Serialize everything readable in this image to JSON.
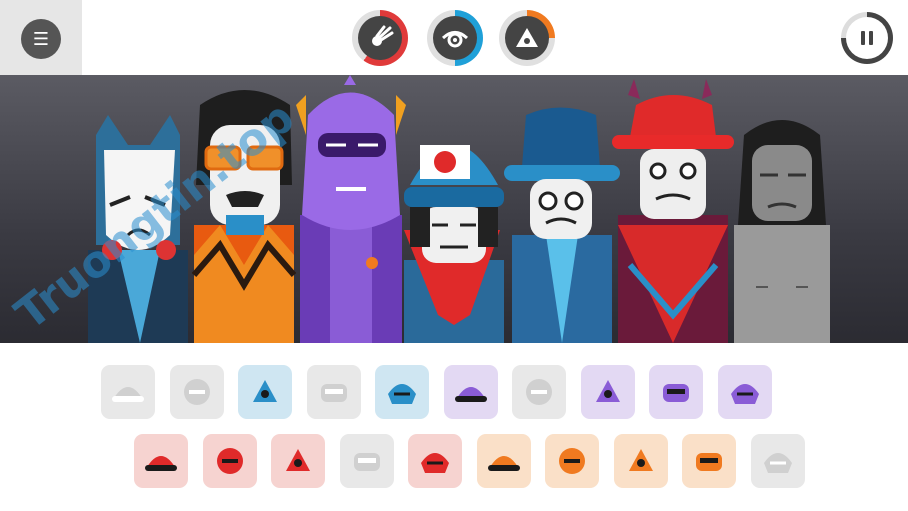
{
  "topbar": {
    "menu_icon": "hamburger-icon",
    "mode_buttons": [
      {
        "icon": "meteor-icon",
        "ring_color": "#e03a3a",
        "progress": 0.6
      },
      {
        "icon": "eye-icon",
        "ring_color": "#1fa0d8",
        "progress": 0.5
      },
      {
        "icon": "triangle-icon",
        "ring_color": "#f07a20",
        "progress": 0.25
      }
    ],
    "pause_icon": "pause-icon"
  },
  "stage": {
    "characters": [
      {
        "name": "white-mask-character",
        "color": "#2d7fb0"
      },
      {
        "name": "orange-glasses-character",
        "color": "#e85a10"
      },
      {
        "name": "purple-helmet-character",
        "color": "#8a5cd6"
      },
      {
        "name": "japan-cap-character",
        "color": "#e02a2a"
      },
      {
        "name": "blue-hat-character",
        "color": "#2a8fc8"
      },
      {
        "name": "red-hat-character",
        "color": "#d82a2a"
      },
      {
        "name": "grey-character",
        "color": "#9a9a9a"
      }
    ]
  },
  "tray": {
    "row1": [
      {
        "icon": "cap-icon",
        "bg": "#e8e8e8"
      },
      {
        "icon": "hat-icon",
        "bg": "#e8e8e8"
      },
      {
        "icon": "blue-cap-icon",
        "bg": "#cfe6f2"
      },
      {
        "icon": "mask-icon",
        "bg": "#e8e8e8"
      },
      {
        "icon": "visor-icon",
        "bg": "#cfe6f2"
      },
      {
        "icon": "headphones-icon",
        "bg": "#e3d9f3"
      },
      {
        "icon": "helmet-icon",
        "bg": "#e8e8e8"
      },
      {
        "icon": "purple-mask-icon",
        "bg": "#e3d9f3"
      },
      {
        "icon": "sunglasses-icon",
        "bg": "#e3d9f3"
      },
      {
        "icon": "purple-box-icon",
        "bg": "#e3d9f3"
      }
    ],
    "row2": [
      {
        "icon": "red-hood-icon",
        "bg": "#f6d3d0"
      },
      {
        "icon": "red-bird-icon",
        "bg": "#f6d3d0"
      },
      {
        "icon": "red-cat-icon",
        "bg": "#f6d3d0"
      },
      {
        "icon": "white-hat-icon",
        "bg": "#e8e8e8"
      },
      {
        "icon": "red-face-icon",
        "bg": "#f6d3d0"
      },
      {
        "icon": "orange-cap-icon",
        "bg": "#fae0c8"
      },
      {
        "icon": "orange-goggles-icon",
        "bg": "#fae0c8"
      },
      {
        "icon": "orange-band-icon",
        "bg": "#fae0c8"
      },
      {
        "icon": "fox-icon",
        "bg": "#fae0c8"
      },
      {
        "icon": "white-glasses-icon",
        "bg": "#e8e8e8"
      }
    ]
  },
  "watermark": "Truongtin.top"
}
